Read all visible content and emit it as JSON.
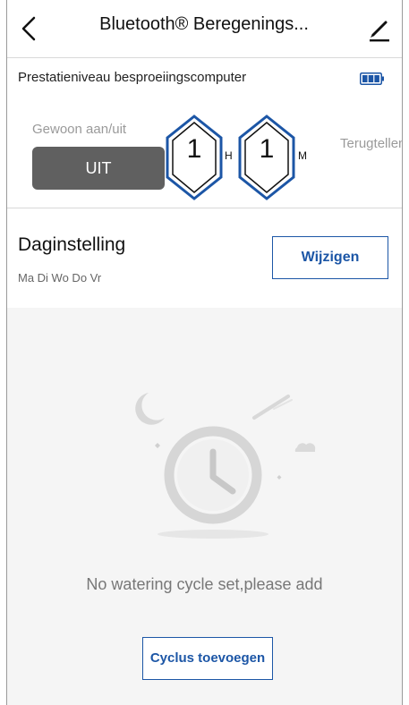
{
  "header": {
    "title": "Bluetooth® Beregenings...",
    "back_icon": "chevron-left-icon",
    "edit_icon": "pencil-icon"
  },
  "performance": {
    "label": "Prestatieniveau besproeiingscomputer",
    "battery_icon": "battery-icon",
    "battery_level": 1.0
  },
  "manual": {
    "label": "Gewoon aan/uit",
    "button_label": "UIT",
    "hours": "1",
    "hours_unit": "H",
    "minutes": "1",
    "minutes_unit": "M",
    "countdown_label": "Terugtellen"
  },
  "day_setting": {
    "title": "Daginstelling",
    "days": "Ma Di Wo Do Vr",
    "change_button": "Wijzigen"
  },
  "empty_state": {
    "illustration_icon": "clock-icon",
    "message": "No watering cycle set,please add",
    "add_button": "Cyclus toevoegen"
  },
  "colors": {
    "accent": "#1c56a6",
    "button_dark": "#606060",
    "empty_bg": "#f5f5f5"
  }
}
